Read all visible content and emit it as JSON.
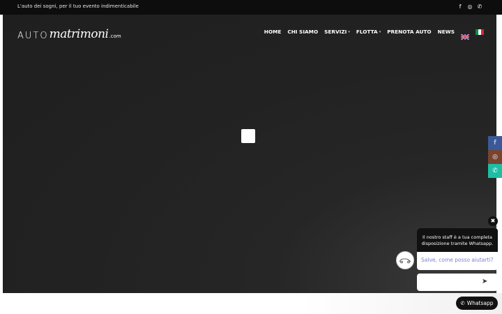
{
  "topbar": {
    "tagline": "L'auto dei sogni, per il tuo evento indimenticabile",
    "socials": [
      {
        "icon": "facebook-icon",
        "glyph": "f"
      },
      {
        "icon": "instagram-icon",
        "glyph": "◎"
      },
      {
        "icon": "whatsapp-icon",
        "glyph": "✆"
      }
    ]
  },
  "logo": {
    "part1": "AUTO",
    "part2": "matrimoni",
    "part3": ".com"
  },
  "nav": {
    "items": [
      {
        "label": "HOME",
        "dropdown": false
      },
      {
        "label": "CHI SIAMO",
        "dropdown": false
      },
      {
        "label": "SERVIZI",
        "dropdown": true
      },
      {
        "label": "FLOTTA",
        "dropdown": true
      },
      {
        "label": "PRENOTA AUTO",
        "dropdown": false
      },
      {
        "label": "NEWS",
        "dropdown": false
      }
    ],
    "languages": [
      "en",
      "it"
    ]
  },
  "sidebar_social": [
    {
      "icon": "facebook-icon",
      "glyph": "f",
      "color": "#3b5998"
    },
    {
      "icon": "instagram-icon",
      "glyph": "◎",
      "color": "#774430"
    },
    {
      "icon": "whatsapp-icon",
      "glyph": "✆",
      "color": "#1ebea5"
    }
  ],
  "chat": {
    "close_glyph": "✖",
    "header_text": "Il nostro staff è a tua completa disposizione tramite Whatsapp.",
    "greeting": "Salve, come posso aiutarti?",
    "input_placeholder": "",
    "send_glyph": "➤",
    "button_label": "Whatsapp",
    "button_glyph": "✆"
  },
  "colors": {
    "topbar_bg": "#0d0d0d",
    "hero_bg": "#222222",
    "greeting_color": "#7a7fd4"
  }
}
